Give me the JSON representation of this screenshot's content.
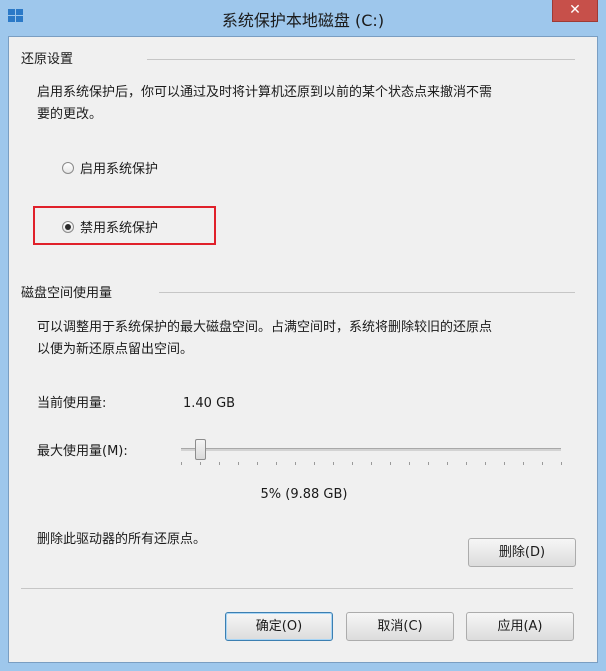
{
  "window": {
    "title": "系统保护本地磁盘 (C:)",
    "close_glyph": "✕"
  },
  "restore_settings": {
    "header": "还原设置",
    "description_line1": "启用系统保护后，你可以通过及时将计算机还原到以前的某个状态点来撤消不需",
    "description_line2": "要的更改。",
    "options": [
      {
        "label": "启用系统保护",
        "checked": false
      },
      {
        "label": "禁用系统保护",
        "checked": true
      }
    ]
  },
  "disk_usage": {
    "header": "磁盘空间使用量",
    "description_line1": "可以调整用于系统保护的最大磁盘空间。占满空间时，系统将删除较旧的还原点",
    "description_line2": "以便为新还原点留出空间。",
    "current_label": "当前使用量:",
    "current_value": "1.40 GB",
    "max_label": "最大使用量(M):",
    "slider_percent": 5,
    "slider_readout": "5% (9.88 GB)",
    "delete_text": "删除此驱动器的所有还原点。",
    "delete_button": "删除(D)"
  },
  "footer": {
    "ok": "确定(O)",
    "cancel": "取消(C)",
    "apply": "应用(A)"
  },
  "colors": {
    "titlebar": "#9ec7ec",
    "highlight": "#e0202a",
    "close": "#c7504a"
  }
}
